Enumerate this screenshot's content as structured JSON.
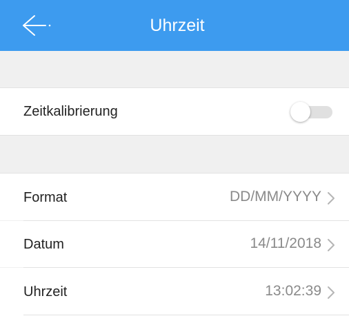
{
  "navbar": {
    "title": "Uhrzeit",
    "back_icon": "arrow-left-icon",
    "color": "#3d9bef"
  },
  "calibration": {
    "label": "Zeitkalibrierung",
    "toggle_on": false
  },
  "settings": [
    {
      "label": "Format",
      "value": "DD/MM/YYYY"
    },
    {
      "label": "Datum",
      "value": "14/11/2018"
    },
    {
      "label": "Uhrzeit",
      "value": "13:02:39"
    }
  ],
  "chevron_icon": "chevron-right-icon"
}
